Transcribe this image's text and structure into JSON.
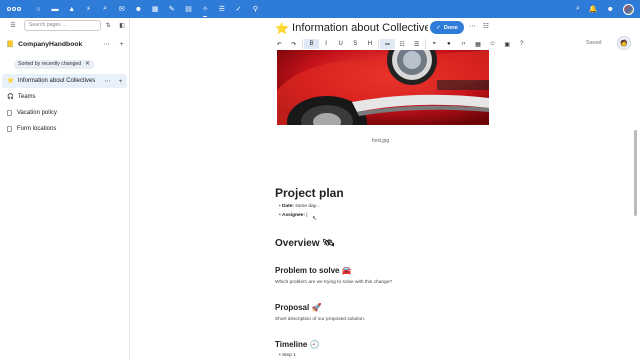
{
  "topbar": {
    "apps": [
      {
        "name": "dashboard-icon",
        "glyph": "○"
      },
      {
        "name": "files-icon",
        "glyph": "▬"
      },
      {
        "name": "photos-icon",
        "glyph": "▲"
      },
      {
        "name": "activity-icon",
        "glyph": "⚡"
      },
      {
        "name": "search-app-icon",
        "glyph": "⌕"
      },
      {
        "name": "mail-icon",
        "glyph": "✉"
      },
      {
        "name": "contacts-icon",
        "glyph": "☻"
      },
      {
        "name": "calendar-icon",
        "glyph": "▦"
      },
      {
        "name": "notes-icon",
        "glyph": "✎"
      },
      {
        "name": "deck-icon",
        "glyph": "▤"
      },
      {
        "name": "collectives-icon",
        "glyph": "✧"
      },
      {
        "name": "list-icon",
        "glyph": "☰"
      },
      {
        "name": "tasks-icon",
        "glyph": "✓"
      },
      {
        "name": "maps-icon",
        "glyph": "⚲"
      }
    ]
  },
  "sidebar": {
    "search_placeholder": "Search pages ...",
    "collective_name": "CompanyHandbook",
    "sorted_label": "Sorted by recently changed",
    "items": [
      {
        "label": "Information about Collectives",
        "active": true
      },
      {
        "label": "Teams"
      },
      {
        "label": "Vacation policy"
      },
      {
        "label": "Form locations"
      }
    ]
  },
  "page": {
    "emoji": "⭐",
    "title": "Information about Collectives",
    "done_label": "Done",
    "saved_label": "Saved"
  },
  "toolbar": {
    "buttons": [
      {
        "name": "undo-icon",
        "glyph": "↶"
      },
      {
        "name": "redo-icon",
        "glyph": "↷"
      },
      {
        "name": "bold-icon",
        "glyph": "B",
        "on": true
      },
      {
        "name": "italic-icon",
        "glyph": "I"
      },
      {
        "name": "underline-icon",
        "glyph": "U"
      },
      {
        "name": "strikethrough-icon",
        "glyph": "S"
      },
      {
        "name": "heading-icon",
        "glyph": "H"
      },
      {
        "name": "bullet-list-icon",
        "glyph": "≔",
        "on": true
      },
      {
        "name": "numbered-list-icon",
        "glyph": "☷"
      },
      {
        "name": "checklist-icon",
        "glyph": "☰"
      },
      {
        "name": "quote-icon",
        "glyph": "❝"
      },
      {
        "name": "info-icon",
        "glyph": "●"
      },
      {
        "name": "code-icon",
        "glyph": "‹›"
      },
      {
        "name": "table-icon",
        "glyph": "▦"
      },
      {
        "name": "emoji-icon",
        "glyph": "☺"
      },
      {
        "name": "image-icon",
        "glyph": "▣"
      },
      {
        "name": "help-icon",
        "glyph": "?"
      }
    ]
  },
  "content": {
    "image_caption": "ford.jpg",
    "h1": "Project plan",
    "bullets": [
      {
        "key": "Date:",
        "value": " some day..."
      },
      {
        "key": "Assignee:",
        "value": " |"
      }
    ],
    "overview": "Overview 🛰",
    "problem": "Problem to solve 🚘",
    "problem_text": "Which problem are we trying to solve with this change?",
    "proposal": "Proposal 🚀",
    "proposal_text": "Short description of our proposed solution.",
    "timeline": "Timeline 🕘",
    "step": "Step 1"
  }
}
